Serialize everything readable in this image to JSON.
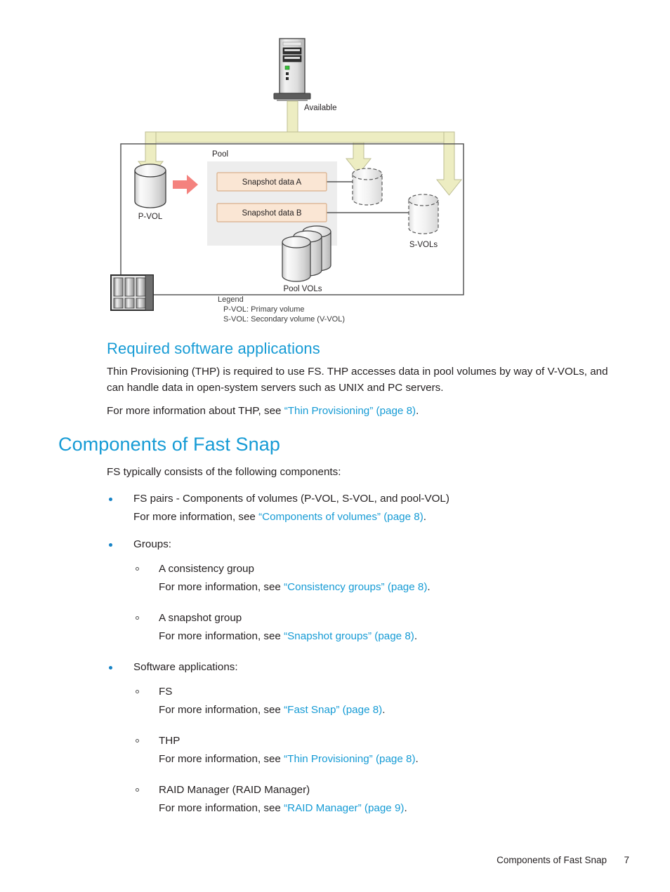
{
  "figure": {
    "name": "fast-snap-components-diagram",
    "labels": {
      "available": "Available",
      "pool": "Pool",
      "pvol": "P-VOL",
      "svols": "S-VOLs",
      "pool_vols": "Pool VOLs",
      "snapshot_a": "Snapshot data A",
      "snapshot_b": "Snapshot data B"
    },
    "legend": {
      "title": "Legend",
      "line1": "P-VOL: Primary volume",
      "line2": "S-VOL: Secondary volume (V-VOL)"
    },
    "colors": {
      "flow_arrow": "#EDEDC2",
      "flow_arrow_stroke": "#B9B98A",
      "copy_arrow": "#F4827E",
      "snapshot_box": "#FAE6D4",
      "snapshot_box_border": "#D9B08C",
      "pool_bg": "#EDEDED",
      "frame": "#4D4D4D",
      "cylinder_light": "#FDFDFD",
      "cylinder_shade": "#BFBFBF"
    }
  },
  "headings": {
    "required_software": "Required software applications",
    "components_of_fast_snap": "Components of Fast Snap"
  },
  "paragraphs": {
    "thp_intro": "Thin Provisioning (THP) is required to use FS. THP accesses data in pool volumes by way of V-VOLs, and can handle data in open-system servers such as UNIX and PC servers.",
    "thp_more_prefix": "For more information about THP, see ",
    "thp_more_link": "“Thin Provisioning” (page 8)",
    "thp_more_suffix": ".",
    "fs_typically": "FS typically consists of the following components:"
  },
  "components_list": [
    {
      "title": "FS pairs - Components of volumes (P-VOL, S-VOL, and pool-VOL)",
      "more_prefix": "For more information, see ",
      "more_link": "“Components of volumes” (page 8)",
      "more_suffix": ".",
      "children": []
    },
    {
      "title": "Groups:",
      "children": [
        {
          "title": "A consistency group",
          "more_prefix": "For more information, see ",
          "more_link": "“Consistency groups” (page 8)",
          "more_suffix": "."
        },
        {
          "title": "A snapshot group",
          "more_prefix": "For more information, see ",
          "more_link": "“Snapshot groups” (page 8)",
          "more_suffix": "."
        }
      ]
    },
    {
      "title": "Software applications:",
      "children": [
        {
          "title": "FS",
          "more_prefix": "For more information, see ",
          "more_link": "“Fast Snap” (page 8)",
          "more_suffix": "."
        },
        {
          "title": "THP",
          "more_prefix": "For more information, see ",
          "more_link": "“Thin Provisioning” (page 8)",
          "more_suffix": "."
        },
        {
          "title": "RAID Manager (RAID Manager)",
          "more_prefix": "For more information, see ",
          "more_link": "“RAID Manager” (page 9)",
          "more_suffix": "."
        }
      ]
    }
  ],
  "footer": {
    "title": "Components of Fast Snap",
    "page": "7"
  },
  "theme": {
    "heading_blue": "#169BD5",
    "link_blue": "#169BD5",
    "bullet_blue": "#1683C6",
    "body_text": "#231f20"
  }
}
